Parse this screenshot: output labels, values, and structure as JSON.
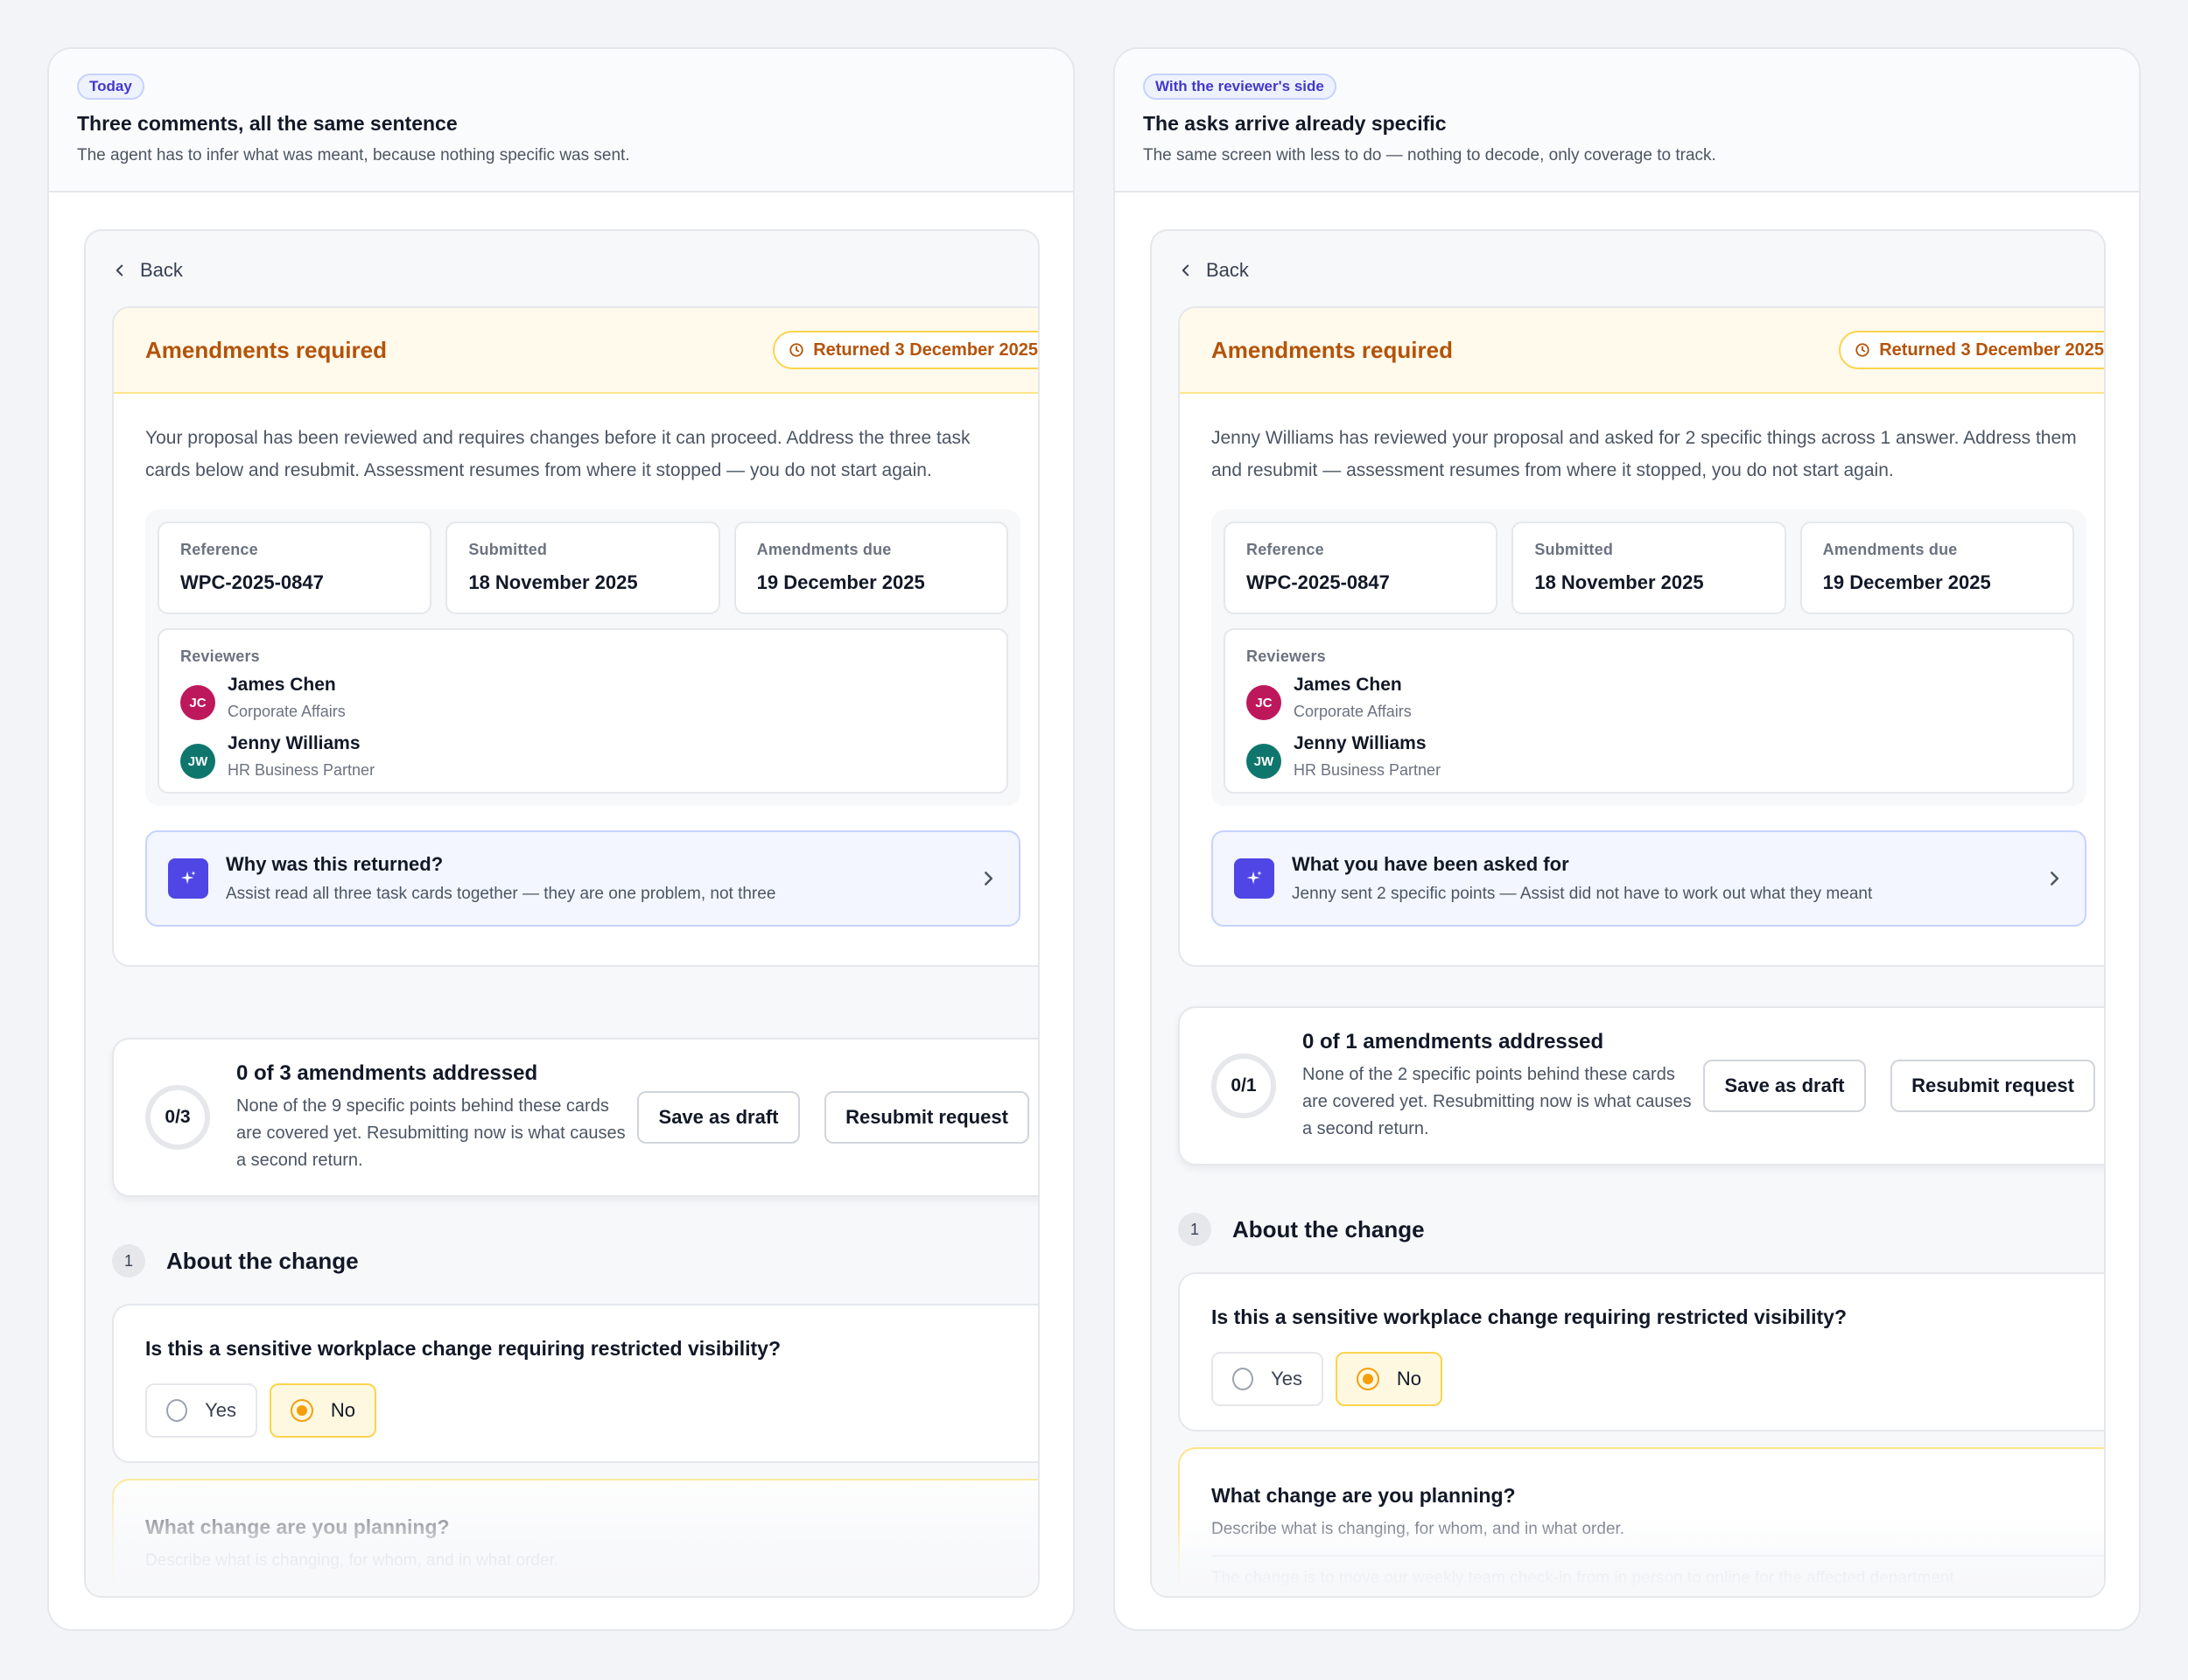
{
  "panels": [
    {
      "tag": "Today",
      "title": "Three comments, all the same sentence",
      "subtitle": "The agent has to infer what was meant, because nothing specific was sent.",
      "back_label": "Back",
      "amend_title": "Amendments required",
      "returned_label": "Returned 3 December 2025",
      "intro": "Your proposal has been reviewed and requires changes before it can proceed. Address the three task cards below and resubmit. Assessment resumes from where it stopped — you do not start again.",
      "meta": [
        {
          "label": "Reference",
          "value": "WPC-2025-0847"
        },
        {
          "label": "Submitted",
          "value": "18 November 2025"
        },
        {
          "label": "Amendments due",
          "value": "19 December 2025"
        }
      ],
      "reviewers_label": "Reviewers",
      "reviewers": [
        {
          "initials": "JC",
          "name": "James Chen",
          "role": "Corporate Affairs",
          "color": "#be185d"
        },
        {
          "initials": "JW",
          "name": "Jenny Williams",
          "role": "HR Business Partner",
          "color": "#0f766e"
        }
      ],
      "assist_title": "Why was this returned?",
      "assist_sub": "Assist read all three task cards together — they are one problem, not three",
      "progress_ring": "0/3",
      "progress_title": "0 of 3 amendments addressed",
      "progress_sub": "None of the 9 specific points behind these cards are covered yet. Resubmitting now is what causes a second return.",
      "save_label": "Save as draft",
      "resubmit_label": "Resubmit request",
      "section_number": "1",
      "section_title": "About the change",
      "question": "Is this a sensitive workplace change requiring restricted visibility?",
      "option_yes": "Yes",
      "option_no": "No",
      "selected": "No",
      "plan_title": "What change are you planning?",
      "plan_sub": "Describe what is changing, for whom, and in what order."
    },
    {
      "tag": "With the reviewer's side",
      "title": "The asks arrive already specific",
      "subtitle": "The same screen with less to do — nothing to decode, only coverage to track.",
      "back_label": "Back",
      "amend_title": "Amendments required",
      "returned_label": "Returned 3 December 2025",
      "intro": "Jenny Williams has reviewed your proposal and asked for 2 specific things across 1 answer. Address them and resubmit — assessment resumes from where it stopped, you do not start again.",
      "meta": [
        {
          "label": "Reference",
          "value": "WPC-2025-0847"
        },
        {
          "label": "Submitted",
          "value": "18 November 2025"
        },
        {
          "label": "Amendments due",
          "value": "19 December 2025"
        }
      ],
      "reviewers_label": "Reviewers",
      "reviewers": [
        {
          "initials": "JC",
          "name": "James Chen",
          "role": "Corporate Affairs",
          "color": "#be185d"
        },
        {
          "initials": "JW",
          "name": "Jenny Williams",
          "role": "HR Business Partner",
          "color": "#0f766e"
        }
      ],
      "assist_title": "What you have been asked for",
      "assist_sub": "Jenny sent 2 specific points — Assist did not have to work out what they meant",
      "progress_ring": "0/1",
      "progress_title": "0 of 1 amendments addressed",
      "progress_sub": "None of the 2 specific points behind these cards are covered yet. Resubmitting now is what causes a second return.",
      "save_label": "Save as draft",
      "resubmit_label": "Resubmit request",
      "section_number": "1",
      "section_title": "About the change",
      "question": "Is this a sensitive workplace change requiring restricted visibility?",
      "option_yes": "Yes",
      "option_no": "No",
      "selected": "No",
      "plan_title": "What change are you planning?",
      "plan_sub": "Describe what is changing, for whom, and in what order.",
      "plan_field_text": "The change is to move our weekly team check-in from in person to online for the affected department"
    }
  ],
  "colors": {
    "amber_text": "#b45309",
    "indigo_accent": "#4f46e5",
    "tag_text": "#4338ca"
  }
}
